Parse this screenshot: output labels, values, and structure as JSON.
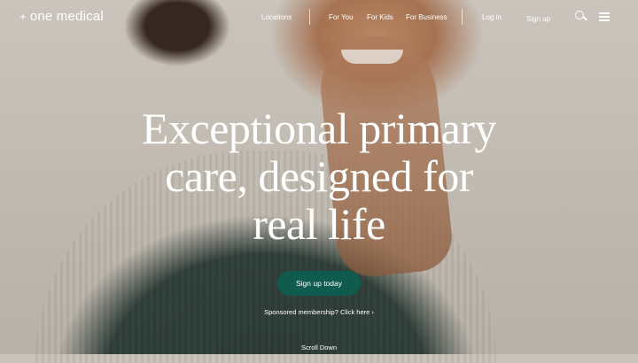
{
  "header": {
    "logo_mark": "+",
    "logo_text": "one medical",
    "nav": {
      "locations": "Locations",
      "for_you": "For You",
      "for_kids": "For Kids",
      "for_business": "For Business",
      "log_in": "Log in",
      "sign_up": "Sign up"
    },
    "icons": {
      "search": "search-icon",
      "menu": "menu-icon"
    }
  },
  "hero": {
    "headline_line1": "Exceptional primary",
    "headline_line2": "care, designed for",
    "headline_line3": "real life",
    "cta_label": "Sign up today",
    "sponsored_text": "Sponsored membership? Click here ›",
    "scroll_label": "Scroll Down"
  },
  "colors": {
    "cta_background": "#0f5b50",
    "text": "#ffffff"
  }
}
